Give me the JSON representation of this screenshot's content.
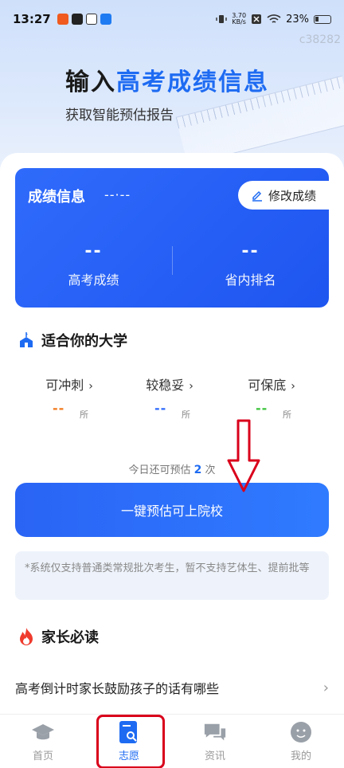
{
  "status_bar": {
    "time": "13:27",
    "net_speed_value": "3.70",
    "net_speed_unit": "KB/s",
    "battery": "23%"
  },
  "watermark": "c38282",
  "hero": {
    "title_plain": "输入",
    "title_accent": "高考成绩信息",
    "subtitle": "获取智能预估报告"
  },
  "score_card": {
    "title": "成绩信息",
    "dash": "--·--",
    "edit_label": "修改成绩",
    "score_value": "--",
    "score_label": "高考成绩",
    "rank_value": "--",
    "rank_label": "省内排名"
  },
  "fit": {
    "title": "适合你的大学",
    "categories": [
      {
        "label": "可冲刺",
        "value": "--",
        "unit": "所",
        "color": "#f07a1e"
      },
      {
        "label": "较稳妥",
        "value": "--",
        "unit": "所",
        "color": "#2f6bfb"
      },
      {
        "label": "可保底",
        "value": "--",
        "unit": "所",
        "color": "#3cc43c"
      }
    ],
    "remain_prefix": "今日还可预估",
    "remain_count": "2",
    "remain_suffix": "次",
    "cta_label": "一键预估可上院校",
    "notice": "*系统仅支持普通类常规批次考生，暂不支持艺体生、提前批等"
  },
  "parents": {
    "title": "家长必读",
    "article": "高考倒计时家长鼓励孩子的话有哪些"
  },
  "nav": [
    {
      "label": "首页",
      "icon": "graduation-cap-icon"
    },
    {
      "label": "志愿",
      "icon": "search-doc-icon",
      "active": true
    },
    {
      "label": "资讯",
      "icon": "chat-bubbles-icon"
    },
    {
      "label": "我的",
      "icon": "user-avatar-icon"
    }
  ],
  "colors": {
    "primary": "#1e6bf2",
    "annotation_red": "#d9001b"
  }
}
